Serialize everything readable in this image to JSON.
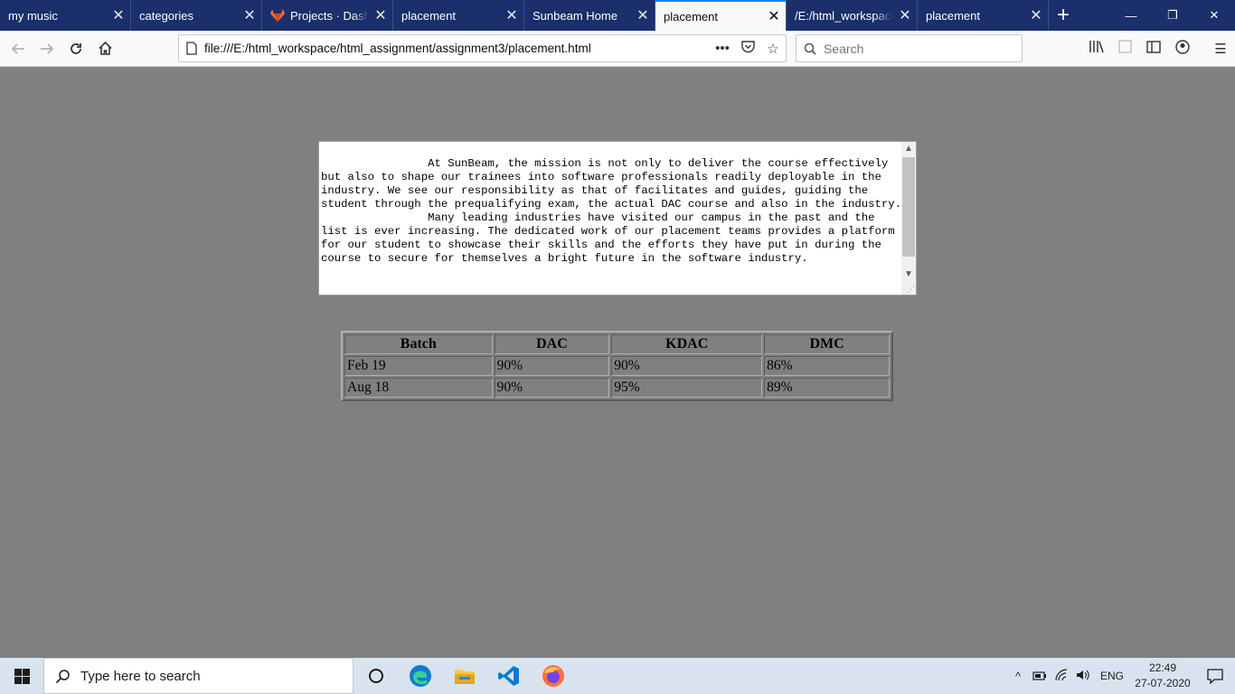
{
  "browser": {
    "tabs": [
      {
        "title": "my music",
        "active": false
      },
      {
        "title": "categories",
        "active": false
      },
      {
        "title": "Projects · Dashboard",
        "active": false,
        "icon": "gitlab-icon"
      },
      {
        "title": "placement",
        "active": false
      },
      {
        "title": "Sunbeam Home",
        "active": false
      },
      {
        "title": "placement",
        "active": true
      },
      {
        "title": "/E:/html_workspace",
        "active": false
      },
      {
        "title": "placement",
        "active": false
      }
    ],
    "url": "file:///E:/html_workspace/html_assignment/assignment3/placement.html",
    "search_placeholder": "Search",
    "accent": "#0a84ff",
    "tabbar_color": "#1a2f6b"
  },
  "page": {
    "background": "#808080",
    "textarea_text": "                At SunBeam, the mission is not only to deliver the course effectively but also to shape our trainees into software professionals readily deployable in the industry. We see our responsibility as that of facilitates and guides, guiding the student through the prequalifying exam, the actual DAC course and also in the industry.\n                Many leading industries have visited our campus in the past and the list is ever increasing. The dedicated work of our placement teams provides a platform for our student to showcase their skills and the efforts they have put in during the course to secure for themselves a bright future in the software industry.",
    "table": {
      "headers": [
        "Batch",
        "DAC",
        "KDAC",
        "DMC"
      ],
      "rows": [
        [
          "Feb 19",
          "90%",
          "90%",
          "86%"
        ],
        [
          "Aug 18",
          "90%",
          "95%",
          "89%"
        ]
      ]
    }
  },
  "taskbar": {
    "search_placeholder": "Type here to search",
    "language": "ENG",
    "time": "22:49",
    "date": "27-07-2020"
  }
}
